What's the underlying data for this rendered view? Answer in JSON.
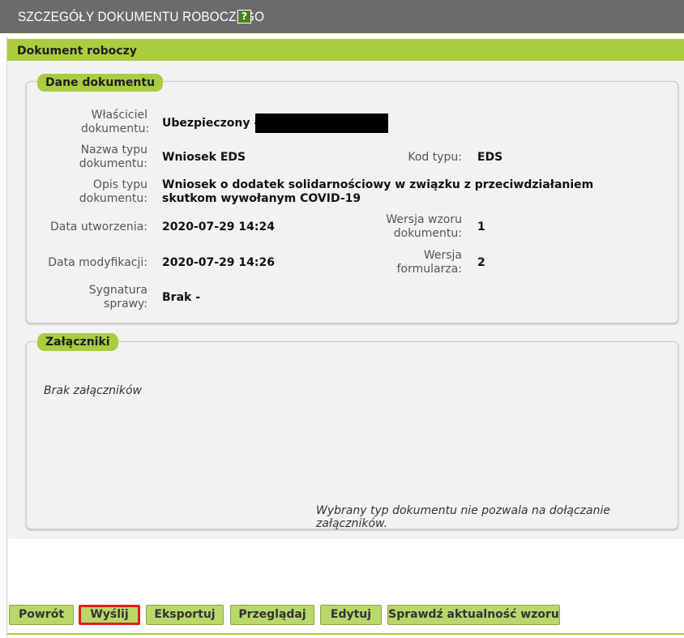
{
  "header": {
    "title": "SZCZEGÓŁY DOKUMENTU ROBOCZEGO",
    "help_icon": "?"
  },
  "section": {
    "title": "Dokument roboczy"
  },
  "details": {
    "tag": "Dane dokumentu",
    "owner_label": "Właściciel dokumentu:",
    "owner_value": "Ubezpieczony -",
    "type_name_label": "Nazwa typu dokumentu:",
    "type_name_value": "Wniosek EDS",
    "type_code_label": "Kod typu:",
    "type_code_value": "EDS",
    "type_desc_label": "Opis typu dokumentu:",
    "type_desc_value": "Wniosek o dodatek solidarnościowy w związku z przeciwdziałaniem skutkom wywołanym COVID-19",
    "created_label": "Data utworzenia:",
    "created_value": "2020-07-29 14:24",
    "template_version_label": "Wersja wzoru dokumentu:",
    "template_version_value": "1",
    "modified_label": "Data modyfikacji:",
    "modified_value": "2020-07-29 14:26",
    "form_version_label": "Wersja formularza:",
    "form_version_value": "2",
    "case_sig_label": "Sygnatura sprawy:",
    "case_sig_value": "Brak -"
  },
  "attachments": {
    "tag": "Załączniki",
    "empty_text": "Brak załączników",
    "note": "Wybrany typ dokumentu nie pozwala na dołączanie załączników."
  },
  "buttons": {
    "back": "Powrót",
    "send": "Wyślij",
    "export": "Eksportuj",
    "browse": "Przeglądaj",
    "edit": "Edytuj",
    "check": "Sprawdź aktualność wzoru"
  },
  "colors": {
    "header_bg": "#6b6b6b",
    "accent_green": "#a9cd3f",
    "button_green": "#b9d86a",
    "highlight_red": "#e01e1e"
  }
}
